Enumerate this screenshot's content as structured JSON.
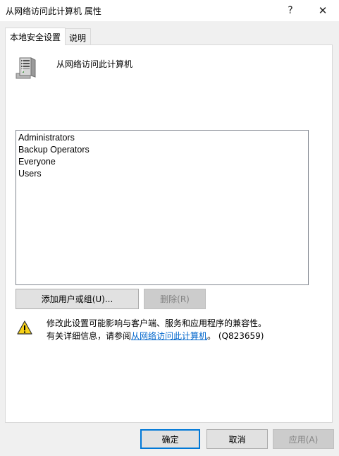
{
  "window": {
    "title": "从网络访问此计算机 属性",
    "help_glyph": "?",
    "close_glyph": "✕"
  },
  "tabs": [
    {
      "label": "本地安全设置",
      "active": true
    },
    {
      "label": "说明",
      "active": false
    }
  ],
  "policy": {
    "icon": "server-icon",
    "name": "从网络访问此计算机"
  },
  "members": [
    "Administrators",
    "Backup Operators",
    "Everyone",
    "Users"
  ],
  "buttons": {
    "add": "添加用户或组(U)...",
    "remove": "删除(R)",
    "ok": "确定",
    "cancel": "取消",
    "apply": "应用(A)"
  },
  "warning": {
    "icon": "warning-icon",
    "line1": "修改此设置可能影响与客户端、服务和应用程序的兼容性。",
    "line2_prefix": "有关详细信息，请参阅",
    "link_text": "从网络访问此计算机",
    "line2_suffix": "。 (Q823659)"
  },
  "colors": {
    "accent": "#0078d7",
    "link": "#0066cc",
    "warning_yellow": "#f7d117"
  }
}
